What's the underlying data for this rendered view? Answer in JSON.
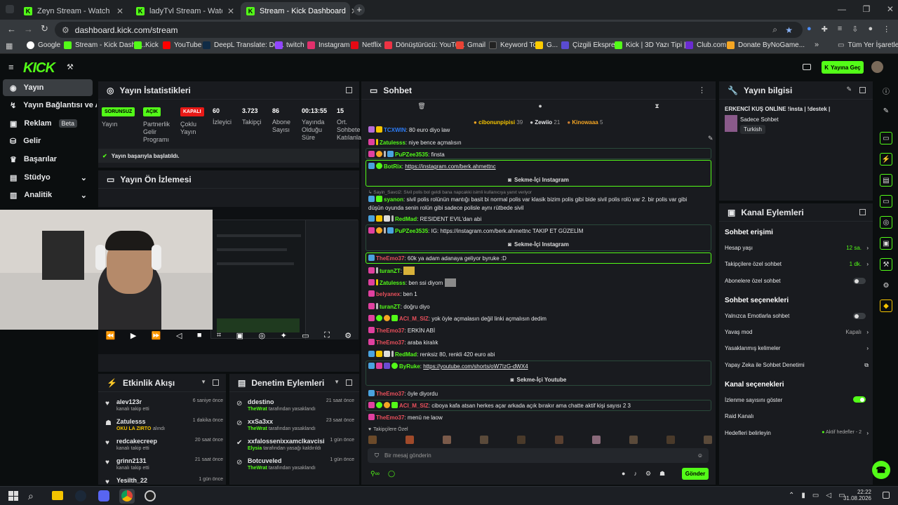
{
  "browser": {
    "tabs": [
      {
        "label": "Zeyn Stream - Watch Live on Ki"
      },
      {
        "label": "ladyTvl Stream - Watch Live on"
      },
      {
        "label": "Stream - Kick Dashboard"
      }
    ],
    "url": "dashboard.kick.com/stream",
    "bookmarks": [
      {
        "label": "Google",
        "color": "#fff"
      },
      {
        "label": "Stream - Kick Dashb...",
        "color": "#53fc18"
      },
      {
        "label": "Kick",
        "color": "#53fc18"
      },
      {
        "label": "YouTube",
        "color": "#ff0000"
      },
      {
        "label": "DeepL Translate: Dü...",
        "color": "#0f2b46"
      },
      {
        "label": "twitch",
        "color": "#9146ff"
      },
      {
        "label": "Instagram",
        "color": "#e1306c"
      },
      {
        "label": "Netflix",
        "color": "#e50914"
      },
      {
        "label": "Dönüştürücü: YouTu...",
        "color": "#e34"
      },
      {
        "label": "Gmail",
        "color": "#ea4335"
      },
      {
        "label": "Keyword Tool",
        "color": "#222"
      },
      {
        "label": "G...",
        "color": "#ffcc00"
      },
      {
        "label": "Çizgili Ekspres",
        "color": "#5a4bd1"
      },
      {
        "label": "Kick | 3D Yazı Tipi |...",
        "color": "#53fc18"
      },
      {
        "label": "Club.com",
        "color": "#6a2bd1"
      },
      {
        "label": "Donate ByNoGame...",
        "color": "#f5a623"
      }
    ],
    "all_bookmarks": "Tüm Yer İşaretleri"
  },
  "header": {
    "logo": "KICK",
    "go_live": "Yayına Geç"
  },
  "sidebar": {
    "items": [
      {
        "label": "Yayın"
      },
      {
        "label": "Yayın Bağlantısı ve Anahtarı"
      },
      {
        "label": "Reklam",
        "badge": "Beta"
      },
      {
        "label": "Gelir"
      },
      {
        "label": "Başarılar"
      },
      {
        "label": "Stüdyo"
      },
      {
        "label": "Analitik"
      }
    ]
  },
  "stats": {
    "title": "Yayın İstatistikleri",
    "tags": [
      {
        "tag": "SORUNSUZ",
        "label": "Yayın",
        "color": "#53fc18"
      },
      {
        "tag": "AÇIK",
        "label": "Partnerlik Gelir Programı",
        "color": "#53fc18"
      },
      {
        "tag": "KAPALI",
        "label": "Çoklu Yayın",
        "color": "#e91916"
      }
    ],
    "values": [
      {
        "value": "60",
        "label": "İzleyici"
      },
      {
        "value": "3.723",
        "label": "Takipçi"
      },
      {
        "value": "86",
        "label": "Abone Sayısı"
      },
      {
        "value": "00:13:55",
        "label": "Yayında Olduğu Süre"
      },
      {
        "value": "15",
        "label": "Ort. Sohbete Katılanlar"
      }
    ],
    "success": "Yayın başarıyla başlatıldı."
  },
  "preview": {
    "title": "Yayın Ön İzlemesi"
  },
  "activity": {
    "title": "Etkinlik Akışı",
    "items": [
      {
        "name": "alev123r",
        "sub": "kanalı takip etti",
        "time": "6 saniye önce",
        "sub_color": "#aaa"
      },
      {
        "name": "Zatulesss",
        "sub": "OKU LA ZIRTO",
        "sub2": "alındı",
        "time": "1 dakika önce",
        "sub_color": "#f5c400"
      },
      {
        "name": "redcakecreep",
        "sub": "kanalı takip etti",
        "time": "20 saat önce",
        "sub_color": "#aaa"
      },
      {
        "name": "grinn2131",
        "sub": "kanalı takip etti",
        "time": "21 saat önce",
        "sub_color": "#aaa"
      },
      {
        "name": "Yesilth_22",
        "sub": "",
        "time": "1 gün önce",
        "sub_color": "#aaa"
      }
    ]
  },
  "moderation": {
    "title": "Denetim Eylemleri",
    "items": [
      {
        "name": "ddestino",
        "by": "TheWrat",
        "sub": "tarafından yasaklandı",
        "time": "21 saat önce"
      },
      {
        "name": "xxSa3xx",
        "by": "TheWrat",
        "sub": "tarafından yasaklandı",
        "time": "23 saat önce"
      },
      {
        "name": "xxfalossenixxamclkavcisi",
        "by": "Elysia",
        "sub": "tarafından yasağı kaldırıldı",
        "time": "1 gün önce"
      },
      {
        "name": "Botcuveled",
        "by": "TheWrat",
        "sub": "tarafından yasaklandı",
        "time": "1 gün önce"
      }
    ]
  },
  "chat": {
    "title": "Sohbet",
    "top_gifters": [
      {
        "name": "cibonunpipisi",
        "count": "39"
      },
      {
        "name": "Zewiio",
        "count": "21"
      },
      {
        "name": "Kinowaaa",
        "count": "5"
      }
    ],
    "messages": [
      {
        "user": "TCXWIN",
        "text": "80 euro diyo law",
        "color": "#2d7cf6"
      },
      {
        "user": "Zatulesss",
        "text": "niye bence açmalısın",
        "color": "#53fc18"
      },
      {
        "user": "PuPZee3535",
        "text": "finsta",
        "color": "#53fc18"
      },
      {
        "user": "BotRix",
        "text": "https://instagram.com/berk.ahmettnc",
        "color": "#53fc18"
      },
      {
        "user": "Sayin_Savci2",
        "text": "Sivil polis bol geldi bana napcakki isimli kullanıcıya yanıt veriyor",
        "color": "#888"
      },
      {
        "user": "syanon",
        "text": "sivil polis rolünün mantığı basit bi normal polis var klasik bizim polis gibi bide sivil polis rolü var 2. bir polis var gibi",
        "color": "#53fc18"
      },
      {
        "user": "",
        "text": "düşün oyunda senin rolün gibi sadece polisle aynı rütbede sivil",
        "color": "#fff"
      },
      {
        "user": "RedMad",
        "text": "RESIDENT EVIL'dan abi",
        "color": "#53fc18"
      },
      {
        "user": "PuPZee3535",
        "text": "IG: https://instagram.com/berk.ahmettnc TAKIP ET GÜZELİM",
        "color": "#53fc18"
      },
      {
        "user": "TheEmo37",
        "text": "60k ya adam adanaya geliyor byruke :D",
        "color": "#e84f5b"
      },
      {
        "user": "turanZT",
        "text": "",
        "color": "#53fc18"
      },
      {
        "user": "Zatulesss",
        "text": "ben ssi diyom",
        "color": "#53fc18"
      },
      {
        "user": "belyanex",
        "text": "ben 1",
        "color": "#e84f5b"
      },
      {
        "user": "turanZT",
        "text": "doğru diyo",
        "color": "#53fc18"
      },
      {
        "user": "ACI_M_SIZ",
        "text": "yok öyle açmalasın değil linki açmalısın dedim",
        "color": "#e84f5b"
      },
      {
        "user": "TheEmo37",
        "text": "ERKİN ABİ",
        "color": "#e84f5b"
      },
      {
        "user": "TheEmo37",
        "text": "araba kiralık",
        "color": "#e84f5b"
      },
      {
        "user": "RedMad",
        "text": "renksiz 80, renkli 420 euro abi",
        "color": "#53fc18"
      },
      {
        "user": "ByRuke",
        "text": "https://youtube.com/shorts/oW7IzG-dWX4",
        "color": "#53fc18"
      },
      {
        "user": "TheEmo37",
        "text": "öyle diyordu",
        "color": "#e84f5b"
      },
      {
        "user": "ACI_M_SIZ",
        "text": "ciboya kafa atsan herkes açar arkada açık bırakır ama chatte aktif kişi sayısı 2 3",
        "color": "#e84f5b"
      },
      {
        "user": "TheEmo37",
        "text": "menü ne laow",
        "color": "#e84f5b"
      }
    ],
    "instagram_btn": "Sekme-İçi Instagram",
    "youtube_btn": "Sekme-İçi Youtube",
    "followers_label": "Takipçilere Özel",
    "placeholder": "Bir mesaj gönderin",
    "send": "Gönder"
  },
  "stream_info": {
    "title": "Yayın bilgisi",
    "stream_title": "ERKENCİ KUŞ ONLİNE !insta | !destek |",
    "category": "Sadece Sohbet",
    "language": "Turkish"
  },
  "channel": {
    "title": "Kanal Eylemleri",
    "chat_access": "Sohbet erişimi",
    "account_age": "Hesap yaşı",
    "account_age_val": "12 sa.",
    "follower_chat": "Takipçilere özel sohbet",
    "follower_chat_val": "1 dk.",
    "sub_chat": "Abonelere özel sohbet",
    "chat_options": "Sohbet seçenekleri",
    "emote_only": "Yalnızca Emotlarla sohbet",
    "slow_mode": "Yavaş mod",
    "slow_mode_val": "Kapalı",
    "banned_words": "Yasaklanmış kelimeler",
    "ai_mod": "Yapay Zeka ile Sohbet Denetimi",
    "channel_options": "Kanal seçenekleri",
    "show_viewers": "İzlenme sayısını göster",
    "raid": "Raid Kanalı",
    "goals": "Hedefleri belirleyin",
    "goals_val": "Aktif hedefler - 2"
  },
  "taskbar": {
    "time": "22:22",
    "date": "31.08.2026"
  }
}
